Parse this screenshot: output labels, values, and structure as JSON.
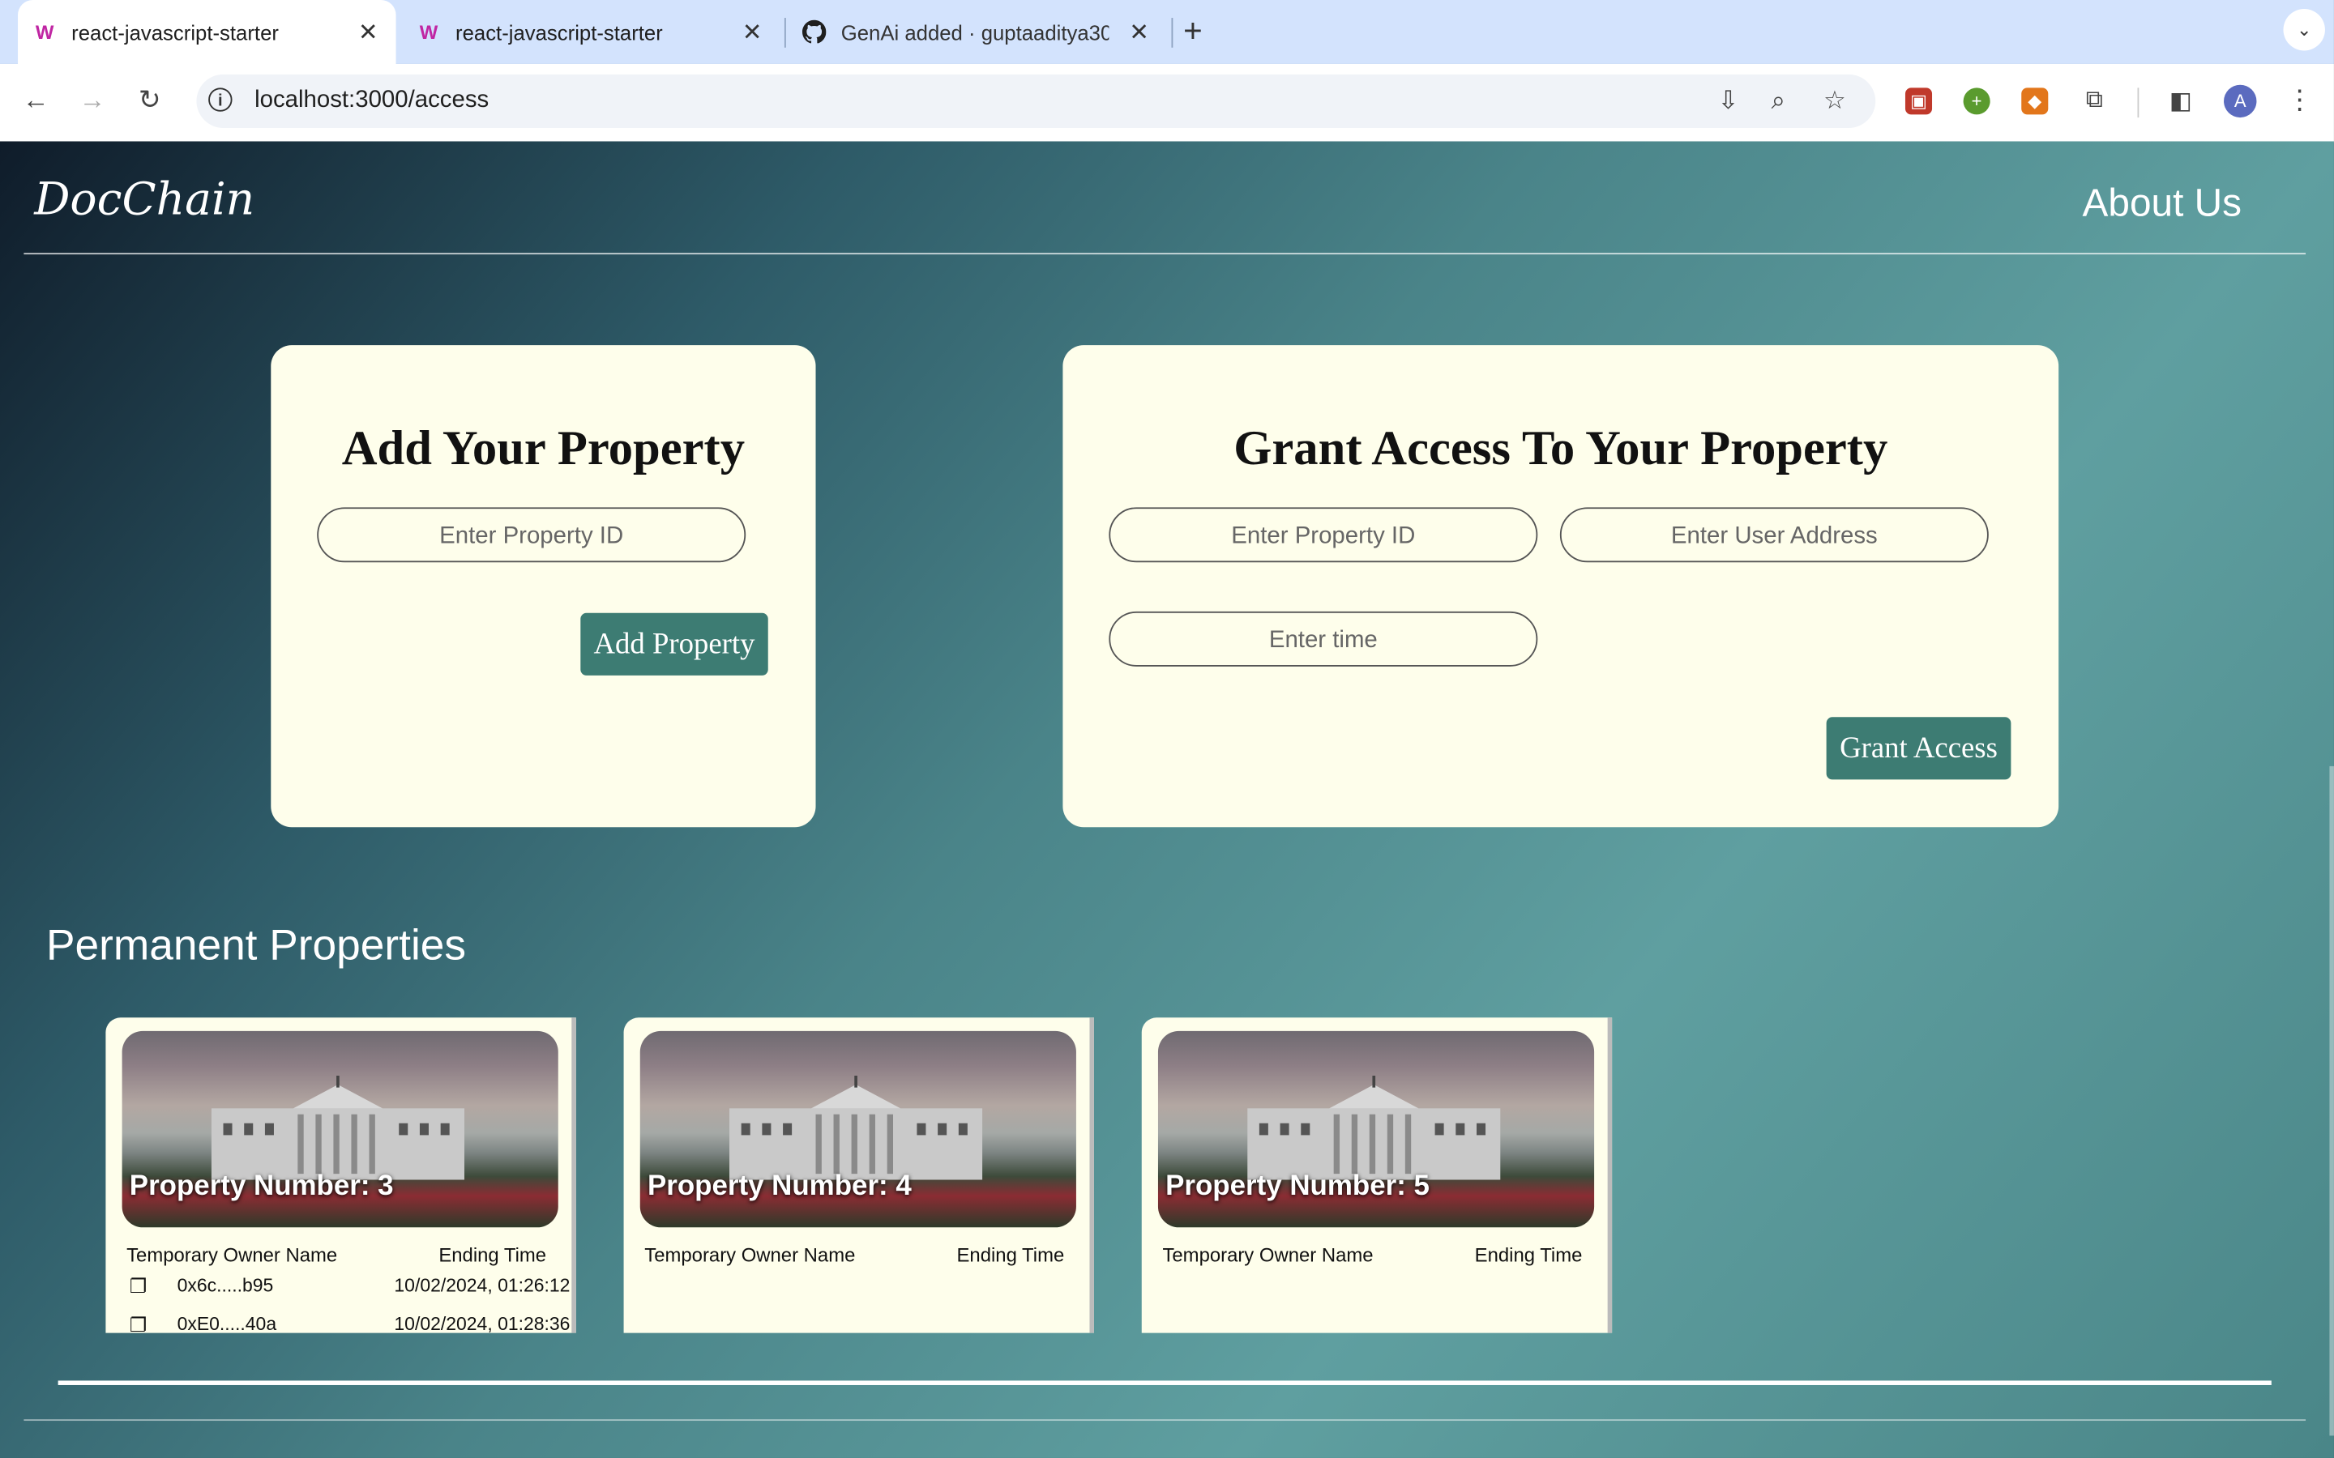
{
  "browser": {
    "tabs": [
      {
        "title": "react-javascript-starter",
        "active": true
      },
      {
        "title": "react-javascript-starter",
        "active": false
      },
      {
        "title": "GenAi added · guptaaditya30",
        "active": false
      }
    ],
    "url": "localhost:3000/access",
    "profile_initial": "A"
  },
  "nav": {
    "logo": "DocChain",
    "about": "About Us"
  },
  "add_card": {
    "title": "Add Your Property",
    "property_id_placeholder": "Enter Property ID",
    "button": "Add Property"
  },
  "grant_card": {
    "title": "Grant Access To Your Property",
    "property_id_placeholder": "Enter Property ID",
    "user_address_placeholder": "Enter User Address",
    "time_placeholder": "Enter time",
    "button": "Grant Access"
  },
  "section_title": "Permanent Properties",
  "properties": [
    {
      "caption": "Property Number: 3",
      "col_owner": "Temporary Owner Name",
      "col_time": "Ending Time",
      "rows": [
        {
          "address": "0x6c.....b95",
          "time": "10/02/2024, 01:26:12"
        },
        {
          "address": "0xE0.....40a",
          "time": "10/02/2024, 01:28:36"
        }
      ]
    },
    {
      "caption": "Property Number: 4",
      "col_owner": "Temporary Owner Name",
      "col_time": "Ending Time",
      "rows": []
    },
    {
      "caption": "Property Number: 5",
      "col_owner": "Temporary Owner Name",
      "col_time": "Ending Time",
      "rows": []
    }
  ],
  "colors": {
    "card_bg": "#fefeeb",
    "button_bg": "#3d7c73"
  }
}
